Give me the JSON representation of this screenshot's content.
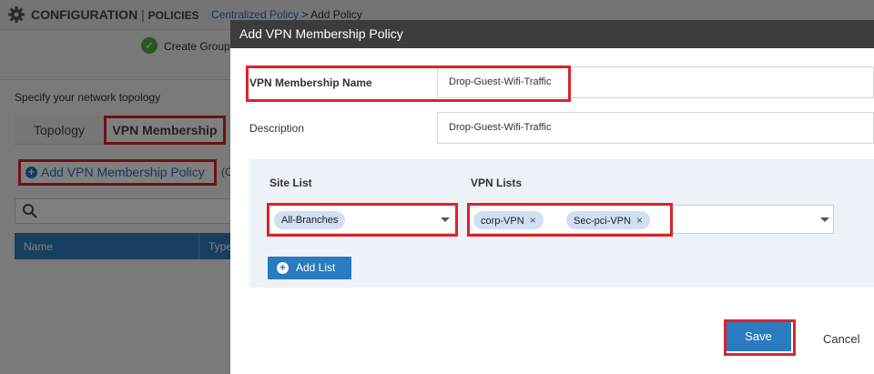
{
  "header": {
    "section": "CONFIGURATION",
    "separator": "|",
    "subsection": "POLICIES",
    "breadcrumb_link": "Centralized Policy",
    "breadcrumb_sep": ">",
    "breadcrumb_current": "Add Policy"
  },
  "wizard": {
    "step_label": "Create Group"
  },
  "page": {
    "topology_label": "Specify your network topology",
    "tabs": [
      "Topology",
      "VPN Membership"
    ],
    "add_policy_label": "Add VPN Membership Policy",
    "paren_text": "(C",
    "table_headers": [
      "Name",
      "Type"
    ]
  },
  "modal": {
    "title": "Add VPN Membership Policy",
    "name_label": "VPN Membership Name",
    "name_value": "Drop-Guest-Wifi-Traffic",
    "description_label": "Description",
    "description_value": "Drop-Guest-Wifi-Traffic",
    "site_list_label": "Site List",
    "vpn_lists_label": "VPN Lists",
    "site_list_selected": "All-Branches",
    "vpn_lists_selected": [
      "corp-VPN",
      "Sec-pci-VPN"
    ],
    "chip_remove_glyph": "×",
    "add_list_label": "Add List",
    "save_label": "Save",
    "cancel_label": "Cancel"
  },
  "colors": {
    "accent": "#2a7bbf",
    "highlight": "#d9242b",
    "modal_header": "#3c3c3c",
    "table_header": "#2f7fc1"
  },
  "icons": [
    "gear-icon",
    "check-icon",
    "plus-circle-icon",
    "search-icon",
    "chevron-down-icon",
    "close-icon"
  ]
}
